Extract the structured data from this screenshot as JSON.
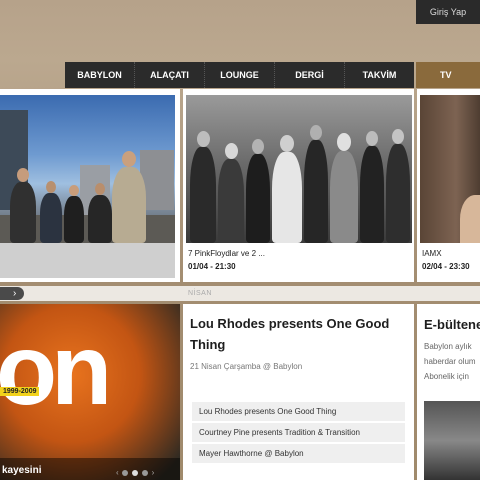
{
  "header": {
    "login_label": "Giriş Yap"
  },
  "nav": {
    "items": [
      "BABYLON",
      "ALAÇATI",
      "LOUNGE",
      "DERGİ",
      "TAKVİM"
    ],
    "tv_label": "TV"
  },
  "featured": [
    {
      "caption": "",
      "date": ""
    },
    {
      "caption": "7 PinkFloydlar ve 2 ...",
      "date": "01/04 - 21:30"
    },
    {
      "caption": "IAMX",
      "date": "02/04 - 23:30"
    }
  ],
  "strip": {
    "month": "NİSAN"
  },
  "promo": {
    "letters": "on",
    "badge": "1999-2009",
    "title": "kayesini"
  },
  "event": {
    "title": "Lou Rhodes presents One Good Thing",
    "date": "21 Nisan Çarşamba @ Babylon",
    "links": [
      "Lou Rhodes presents One Good Thing",
      "Courtney Pine presents Tradition & Transition",
      "Mayer Hawthorne @ Babylon"
    ]
  },
  "newsletter": {
    "title": "E-bültene",
    "lines": [
      "Babylon aylık",
      "haberdar olum",
      "Abonelik için"
    ]
  },
  "colors": {
    "nav_bg": "#2b2b2b",
    "tv_bg": "#8a6a3c",
    "background": "#a38d71"
  }
}
